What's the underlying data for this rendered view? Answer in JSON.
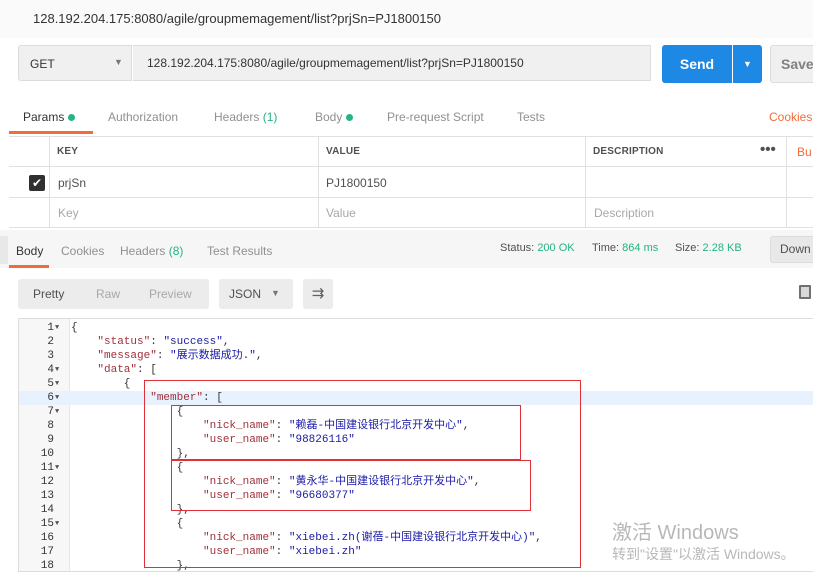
{
  "url_display": "128.192.204.175:8080/agile/groupmemagement/list?prjSn=PJ1800150",
  "request": {
    "method": "GET",
    "url": "128.192.204.175:8080/agile/groupmemagement/list?prjSn=PJ1800150",
    "send_label": "Send",
    "save_label": "Save"
  },
  "request_tabs": {
    "params": "Params",
    "authorization": "Authorization",
    "headers": "Headers",
    "headers_count": "(1)",
    "body": "Body",
    "prerequest": "Pre-request Script",
    "tests": "Tests",
    "cookies": "Cookies",
    "bulk": "Bu"
  },
  "params": {
    "columns": [
      "KEY",
      "VALUE",
      "DESCRIPTION"
    ],
    "rows": [
      {
        "key": "prjSn",
        "value": "PJ1800150",
        "description": ""
      }
    ],
    "placeholders": {
      "key": "Key",
      "value": "Value",
      "description": "Description"
    }
  },
  "response_tabs": {
    "body": "Body",
    "cookies": "Cookies",
    "headers": "Headers",
    "headers_count": "(8)",
    "test_results": "Test Results",
    "download": "Down"
  },
  "response_status": {
    "status_label": "Status:",
    "status_value": "200 OK",
    "time_label": "Time:",
    "time_value": "864 ms",
    "size_label": "Size:",
    "size_value": "2.28 KB"
  },
  "view": {
    "pretty": "Pretty",
    "raw": "Raw",
    "preview": "Preview",
    "format": "JSON"
  },
  "code_lines": [
    {
      "n": "1",
      "fold": true,
      "text": "{"
    },
    {
      "n": "2",
      "fold": false,
      "text": "    \"status\": \"success\","
    },
    {
      "n": "3",
      "fold": false,
      "text": "    \"message\": \"展示数据成功.\","
    },
    {
      "n": "4",
      "fold": true,
      "text": "    \"data\": ["
    },
    {
      "n": "5",
      "fold": true,
      "text": "        {"
    },
    {
      "n": "6",
      "fold": true,
      "text": "            \"member\": [",
      "hl": true
    },
    {
      "n": "7",
      "fold": true,
      "text": "                {"
    },
    {
      "n": "8",
      "fold": false,
      "text": "                    \"nick_name\": \"赖磊-中国建设银行北京开发中心\","
    },
    {
      "n": "9",
      "fold": false,
      "text": "                    \"user_name\": \"98826116\""
    },
    {
      "n": "10",
      "fold": false,
      "text": "                },"
    },
    {
      "n": "11",
      "fold": true,
      "text": "                {"
    },
    {
      "n": "12",
      "fold": false,
      "text": "                    \"nick_name\": \"黄永华-中国建设银行北京开发中心\","
    },
    {
      "n": "13",
      "fold": false,
      "text": "                    \"user_name\": \"96680377\""
    },
    {
      "n": "14",
      "fold": false,
      "text": "                },"
    },
    {
      "n": "15",
      "fold": true,
      "text": "                {"
    },
    {
      "n": "16",
      "fold": false,
      "text": "                    \"nick_name\": \"xiebei.zh(谢蓓-中国建设银行北京开发中心)\","
    },
    {
      "n": "17",
      "fold": false,
      "text": "                    \"user_name\": \"xiebei.zh\""
    },
    {
      "n": "18",
      "fold": false,
      "text": "                },"
    }
  ],
  "watermark": {
    "line1": "激活 Windows",
    "line2": "转到\"设置\"以激活 Windows。"
  },
  "colors": {
    "accent_orange": "#f26b3a",
    "send_blue": "#1e88e5",
    "success_green": "#26b47f",
    "annotation_red": "#e0303a"
  }
}
